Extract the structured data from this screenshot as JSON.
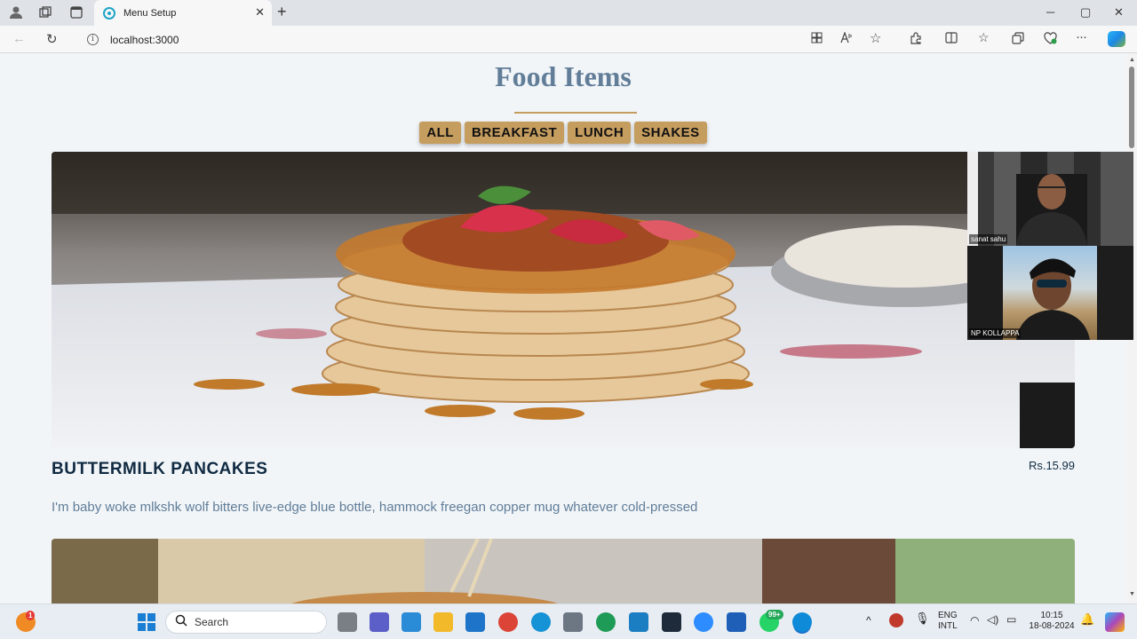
{
  "browser": {
    "tab_title": "Menu Setup",
    "url": "localhost:3000",
    "info_glyph": "i"
  },
  "page": {
    "title": "Food Items",
    "filters": [
      "ALL",
      "BREAKFAST",
      "LUNCH",
      "SHAKES"
    ],
    "items": [
      {
        "name": "BUTTERMILK PANCAKES",
        "price": "Rs.15.99",
        "description": "I'm baby woke mlkshk wolf bitters live-edge blue bottle, hammock freegan copper mug whatever cold-pressed"
      }
    ]
  },
  "video_call": {
    "participants": [
      "sanat sahu",
      "NP KOLLAPPA"
    ]
  },
  "taskbar": {
    "search_placeholder": "Search",
    "language": "ENG",
    "language_sub": "INTL",
    "time": "10:15",
    "date": "18-08-2024",
    "whatsapp_badge": "99+",
    "notification_badge": "1"
  },
  "colors": {
    "accent": "#c59d5f",
    "title": "#617d98",
    "text_dark": "#102a42",
    "page_bg": "#f1f5f8"
  },
  "icons": [
    "profile-icon",
    "workspaces-icon",
    "tab-actions-icon",
    "react-favicon",
    "close-icon",
    "new-tab-icon",
    "minimize-icon",
    "maximize-icon",
    "window-close-icon",
    "back-icon",
    "refresh-icon",
    "info-icon",
    "apps-icon",
    "read-aloud-icon",
    "favorite-star-icon",
    "extensions-icon",
    "split-screen-icon",
    "favorites-icon",
    "collections-icon",
    "browser-essentials-icon",
    "more-icon",
    "copilot-icon",
    "windows-start-icon",
    "search-icon"
  ]
}
